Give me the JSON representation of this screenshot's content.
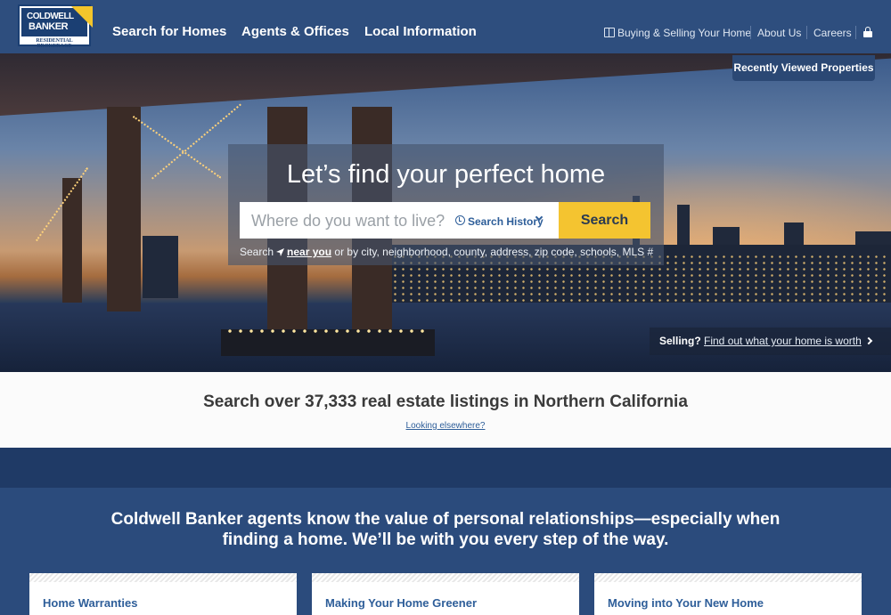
{
  "header": {
    "logo_line1": "COLDWELL",
    "logo_line2": "BANKER",
    "logo_sub": "RESIDENTIAL BROKERAGE",
    "nav_main": [
      "Search for Homes",
      "Agents & Offices",
      "Local Information"
    ],
    "nav_right": [
      "Buying & Selling Your Home",
      "About Us",
      "Careers"
    ],
    "recently_viewed": "Recently Viewed Properties"
  },
  "search": {
    "heading": "Let’s find your perfect home",
    "placeholder": "Where do you want to live?",
    "history_label": "Search History",
    "button_label": "Search",
    "hint_prefix": "Search",
    "hint_near": "near you",
    "hint_suffix": "or by city, neighborhood, county, address, zip code, schools, MLS #"
  },
  "selling": {
    "label": "Selling?",
    "link": "Find out what your home is worth"
  },
  "listings": {
    "title": "Search over 37,333 real estate listings in Northern California",
    "link": "Looking elsewhere?"
  },
  "about": {
    "title": "Coldwell Banker agents know the value of personal relationships—especially when finding a home. We’ll be with you every step of the way."
  },
  "cards": [
    "Home Warranties",
    "Making Your Home Greener",
    "Moving into Your New Home"
  ],
  "colors": {
    "header_bg": "#2e4e7e",
    "accent_yellow": "#f4c430",
    "link_blue": "#2e5e99",
    "section_blue": "#2b4b7c"
  }
}
